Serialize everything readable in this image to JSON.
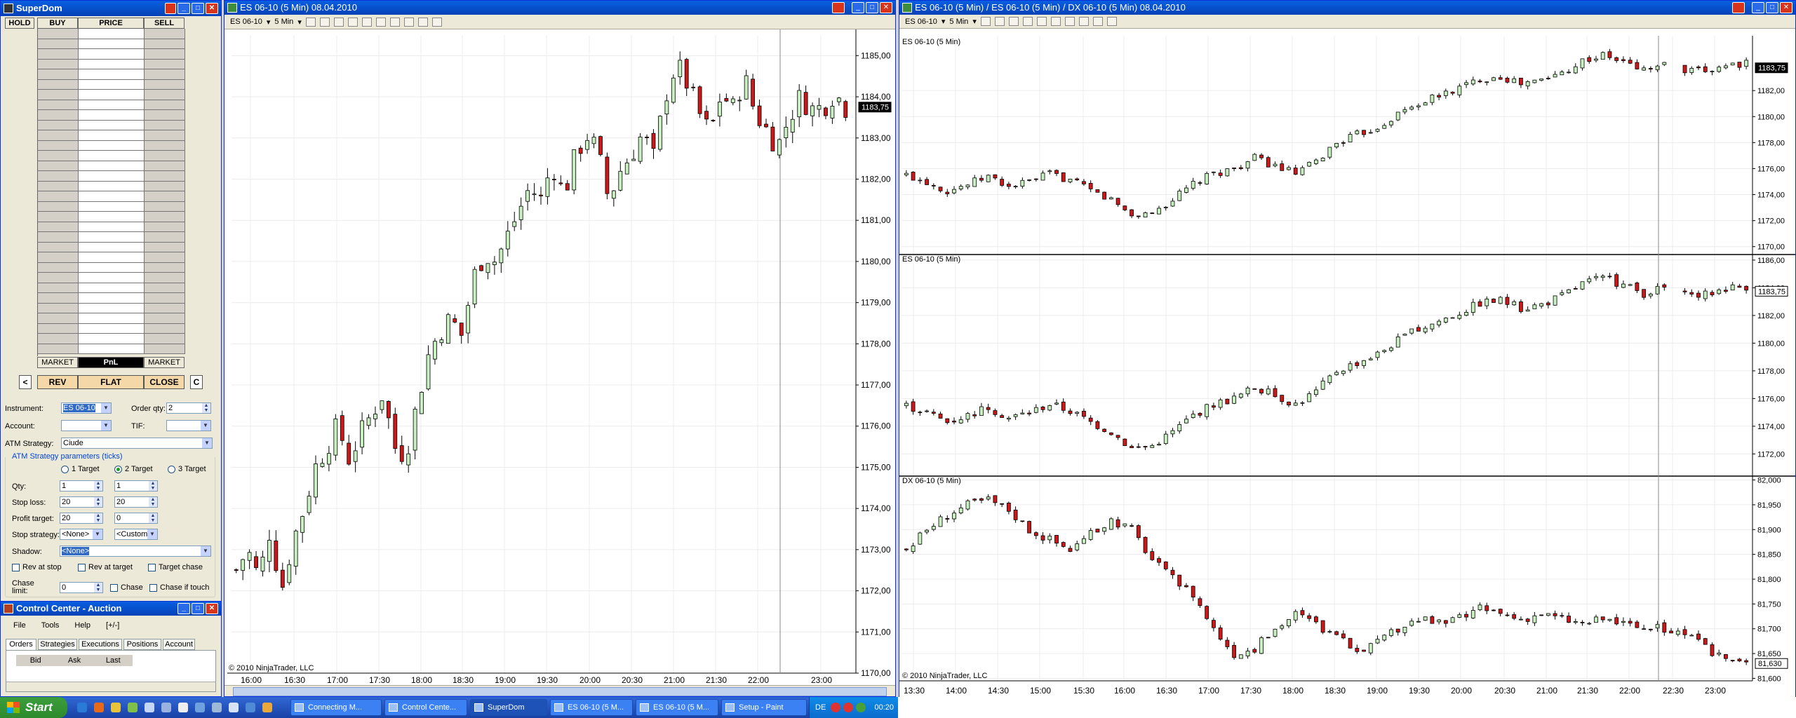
{
  "superdom": {
    "title": "SuperDom",
    "headers": [
      "HOLD",
      "BUY",
      "PRICE",
      "SELL"
    ],
    "market_left": "MARKET",
    "pnl": "PnL",
    "market_right": "MARKET",
    "btn_left_arrow": "<",
    "btn_rev": "REV",
    "btn_flat": "FLAT",
    "btn_close": "CLOSE",
    "btn_c": "C",
    "instrument_label": "Instrument:",
    "instrument_value": "ES 06-10",
    "order_qty_label": "Order qty:",
    "order_qty_value": "2",
    "account_label": "Account:",
    "tif_label": "TIF:",
    "atm_label": "ATM Strategy:",
    "atm_value": "Ciude",
    "atm_params_label": "ATM Strategy parameters (ticks)",
    "target1": "1 Target",
    "target2": "2 Target",
    "target3": "3 Target",
    "qty_label": "Qty:",
    "qty1": "1",
    "qty2": "1",
    "stoploss_label": "Stop loss:",
    "stoploss1": "20",
    "stoploss2": "20",
    "profit_label": "Profit target:",
    "profit1": "20",
    "profit2": "0",
    "stopstrat_label": "Stop strategy:",
    "stopstrat1": "<None>",
    "stopstrat2": "<Custom",
    "shadow_label": "Shadow:",
    "shadow_value": "<None>",
    "rev_at_stop": "Rev at stop",
    "rev_at_target": "Rev at target",
    "target_chase": "Target chase",
    "chase_limit_label": "Chase limit:",
    "chase_limit_value": "0",
    "chase": "Chase",
    "chase_if_touch": "Chase if touch"
  },
  "control_center": {
    "title": "Control Center - Auction",
    "menu": [
      "File",
      "Tools",
      "Help",
      "[+/-]"
    ],
    "tabs": [
      "Orders",
      "Strategies",
      "Executions",
      "Positions",
      "Account"
    ],
    "columns": [
      "Bid",
      "Ask",
      "Last"
    ]
  },
  "chart1": {
    "title": "ES 06-10 (5 Min)  08.04.2010",
    "instrument": "ES 06-10",
    "interval": "5 Min",
    "copyright": "© 2010 NinjaTrader, LLC",
    "price_label": "1183,75"
  },
  "chart2": {
    "title": "ES 06-10 (5 Min) / ES 06-10 (5 Min) / DX 06-10 (5 Min)  08.04.2010",
    "instrument": "ES 06-10",
    "interval": "5 Min",
    "panel1_label": "ES 06-10 (5 Min)",
    "panel2_label": "ES 06-10 (5 Min)",
    "panel3_label": "DX 06-10 (5 Min)",
    "copyright": "© 2010 NinjaTrader, LLC",
    "price_label_es": "1183,75",
    "price_label_dx": "81,630"
  },
  "chart_data": [
    {
      "type": "candlestick",
      "title": "ES 06-10 (5 Min)",
      "x_ticks": [
        "16:00",
        "16:30",
        "17:00",
        "17:30",
        "18:00",
        "18:30",
        "19:00",
        "19:30",
        "20:00",
        "20:30",
        "21:00",
        "21:30",
        "22:00",
        "23:00"
      ],
      "y_ticks": [
        "1185,00",
        "1184,00",
        "1183,00",
        "1182,00",
        "1181,00",
        "1180,00",
        "1179,00",
        "1178,00",
        "1177,00",
        "1176,00",
        "1175,00",
        "1174,00",
        "1173,00",
        "1172,00",
        "1171,00",
        "1170,00"
      ],
      "ylim": [
        1170,
        1185.5
      ],
      "close_path": [
        1172.5,
        1173,
        1172.3,
        1173.5,
        1172,
        1173.2,
        1174,
        1175,
        1175.5,
        1176,
        1175.2,
        1175.8,
        1176.3,
        1176.8,
        1175.5,
        1175.3,
        1176.5,
        1177.7,
        1178.3,
        1178.6,
        1178.2,
        1179.6,
        1180.2,
        1180,
        1180.6,
        1181.2,
        1181.8,
        1181.5,
        1182.4,
        1181.6,
        1182.5,
        1183.1,
        1182.7,
        1181.5,
        1182.2,
        1182.6,
        1183.1,
        1182.5,
        1184,
        1184.8,
        1184.3,
        1183.6,
        1183.1,
        1184.1,
        1183.7,
        1184.5,
        1183.6,
        1183.2,
        1182.8,
        1183.5,
        1184,
        1183.7,
        1183.75,
        1184.1,
        1183.75
      ]
    },
    {
      "type": "candlestick",
      "title": "ES 06-10 (5 Min)",
      "x_ticks": [
        "13:30",
        "14:00",
        "14:30",
        "15:00",
        "15:30",
        "16:00",
        "16:30",
        "17:00",
        "17:30",
        "18:00",
        "18:30",
        "19:00",
        "19:30",
        "20:00",
        "20:30",
        "21:00",
        "21:30",
        "22:00",
        "22:30",
        "23:00"
      ],
      "y_ticks": [
        "1182,00",
        "1180,00",
        "1178,00",
        "1176,00",
        "1174,00",
        "1172,00",
        "1170,00"
      ],
      "ylim": [
        1169.5,
        1186
      ]
    },
    {
      "type": "candlestick",
      "title": "ES 06-10 (5 Min)",
      "y_ticks": [
        "1186,00",
        "1184,00",
        "1182,00",
        "1180,00",
        "1178,00",
        "1176,00",
        "1174,00",
        "1172,00"
      ],
      "ylim": [
        1170.5,
        1186.3
      ]
    },
    {
      "type": "candlestick",
      "title": "DX 06-10 (5 Min)",
      "y_ticks": [
        "82,000",
        "81,950",
        "81,900",
        "81,850",
        "81,800",
        "81,750",
        "81,700",
        "81,650",
        "81,600"
      ],
      "ylim": [
        81.595,
        82.005
      ]
    }
  ]
}
